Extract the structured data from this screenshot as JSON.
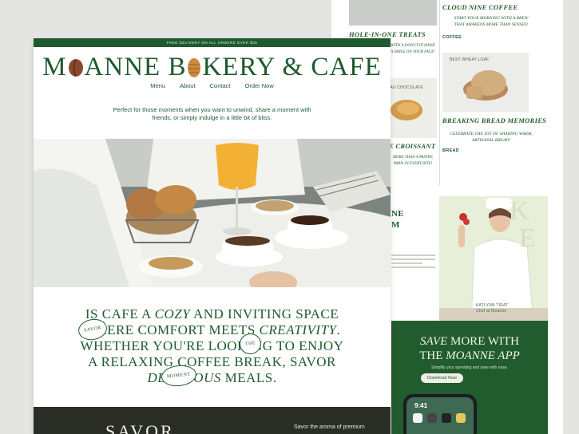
{
  "promo_bar": "FREE DELIVERY ON ALL ORDERS OVER $25",
  "brand": {
    "prefix": "M",
    "middle1": "ANNE B",
    "middle2": "KERY & CAFE"
  },
  "nav": [
    "Menu",
    "About",
    "Contact",
    "Order Now"
  ],
  "tagline": "Perfect for those moments when you want to unwind, share a moment with friends, or simply indulge in a little bit of bliss.",
  "manifesto": {
    "line1a": "IS C",
    "line1b": "AFE A ",
    "line1c": "COZY",
    "line1d": " AND INVITING SPACE",
    "line2a": "WHERE ",
    "line2b": "COMFORT MEETS ",
    "line2c": "CREATIVITY",
    "line3": "WHETHER YOU'RE LOOKING TO ENJOY",
    "line4": "A RELAXING COFFEE BREAK, SAVOR",
    "line5a": "DELICIOUS",
    "line5b": " MEALS.",
    "tags": [
      "SAVOR",
      "THE",
      "MOMENT"
    ]
  },
  "footer": {
    "word": "SAVOR",
    "aroma": "Savor the aroma of premium"
  },
  "back_page": {
    "left_col": {
      "title1": "HOLE-IN-ONE TREATS",
      "snippet1": "WITH A DONUT IN HAND",
      "snippet2": "A SMILE ON YOUR FACE!",
      "tiny_label": "PAIN AU CHOCOLATE",
      "title2": "E CROISSANT",
      "sub2a": "MORE THAN A PASTRY,",
      "sub2b": "PARIS IN EVERY BITE!"
    },
    "right_col": {
      "title1": "CLOUD NINE COFFEE",
      "sub1": "START YOUR MORNING WITH A BREW THAT AWAKENS MORE THAN SENSES!",
      "cat1": "COFFEE",
      "tiny_label": "BEST WHEAT LOAF",
      "title2": "BREAKING BREAD MEMORIES",
      "sub2": "CELEBRATE THE JOY OF SHARING WARM, ARTISANAL BREAD!",
      "cat2": "BREAD"
    },
    "side_heading_a": "NE",
    "side_heading_b": "M",
    "chef_caption": "KATLYNN TIRAT",
    "chef_caption2": "Chef at Moanne"
  },
  "app_card": {
    "title_line1a": "SAVE",
    "title_line1b": " MORE WITH",
    "title_line2a": "THE ",
    "title_line2b": "MOANNE APP",
    "subtitle": "Simplify your spending and save with ease.",
    "button": "Download Now",
    "phone_time": "9:41"
  },
  "colors": {
    "green": "#1f5a2e",
    "cream": "#f3f3ea"
  }
}
